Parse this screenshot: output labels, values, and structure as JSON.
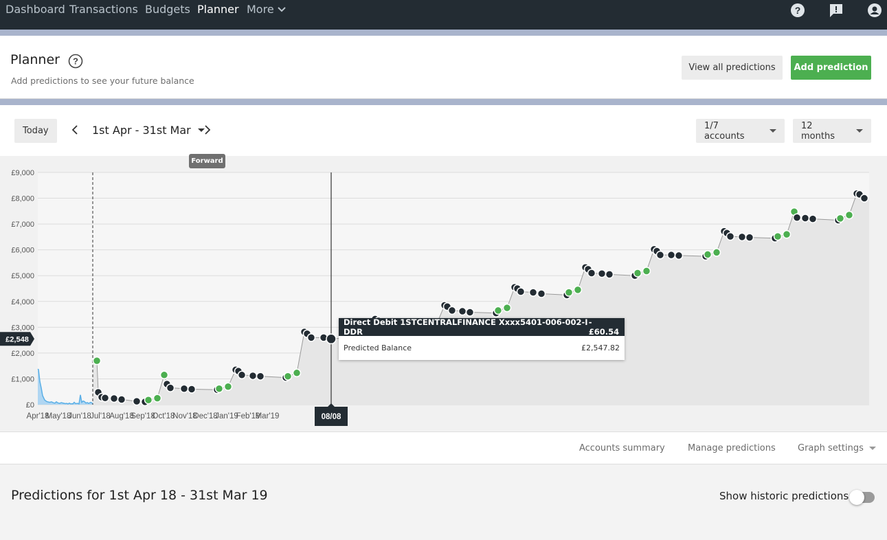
{
  "nav": {
    "items": [
      {
        "label": "Dashboard"
      },
      {
        "label": "Transactions"
      },
      {
        "label": "Budgets"
      },
      {
        "label": "Planner",
        "active": true
      },
      {
        "label": "More"
      }
    ],
    "icons": [
      "help-icon",
      "feedback-icon",
      "account-icon"
    ]
  },
  "header": {
    "title": "Planner",
    "subtitle": "Add predictions to see your future balance",
    "view_all_label": "View all predictions",
    "add_label": "Add prediction"
  },
  "controls": {
    "today_label": "Today",
    "date_range": "1st Apr - 31st Mar",
    "accounts_label": "1/7 accounts",
    "period_label": "12 months",
    "forward_tooltip": "Forward"
  },
  "chart_data": {
    "type": "line",
    "y_ticks": [
      "£0",
      "£1,000",
      "£2,000",
      "£3,000",
      "£4,000",
      "£5,000",
      "£6,000",
      "£7,000",
      "£8,000",
      "£9,000"
    ],
    "ylim": [
      0,
      9000
    ],
    "x_ticks": [
      "Apr'18",
      "May'18",
      "Jun'18",
      "Jul'18",
      "Aug'18",
      "Sep'18",
      "Oct'18",
      "Nov'18",
      "Dec'18",
      "Jan'19",
      "Feb'19",
      "Mar'19"
    ],
    "grid": true,
    "current_balance_label": "£2,548",
    "cursor_date_label": "08/08",
    "colors": {
      "debit": "#232c33",
      "credit": "#4caf50",
      "history": "#5aafe6",
      "history_fill": "#a9d3f2",
      "area": "#e6e6e6"
    },
    "history": [
      [
        0,
        1380
      ],
      [
        1,
        1360
      ],
      [
        3,
        900
      ],
      [
        5,
        650
      ],
      [
        7,
        350
      ],
      [
        10,
        180
      ],
      [
        13,
        120
      ],
      [
        17,
        90
      ],
      [
        20,
        110
      ],
      [
        23,
        70
      ],
      [
        25,
        60
      ],
      [
        27,
        110
      ],
      [
        29,
        70
      ],
      [
        32,
        50
      ],
      [
        34,
        80
      ],
      [
        37,
        60
      ],
      [
        40,
        40
      ],
      [
        42,
        50
      ],
      [
        44,
        30
      ],
      [
        46,
        60
      ],
      [
        48,
        30
      ],
      [
        50,
        40
      ],
      [
        51,
        30
      ],
      [
        53,
        90
      ],
      [
        55,
        40
      ],
      [
        58,
        50
      ],
      [
        60,
        30
      ],
      [
        62,
        380
      ],
      [
        64,
        90
      ],
      [
        66,
        140
      ],
      [
        68,
        120
      ],
      [
        70,
        60
      ],
      [
        72,
        80
      ],
      [
        74,
        50
      ],
      [
        77,
        90
      ],
      [
        80,
        50
      ]
    ],
    "today_x": 80,
    "cursor_x": 427,
    "predicted_points": [
      {
        "x": 86,
        "y": 1700,
        "t": "c"
      },
      {
        "x": 88,
        "y": 480,
        "t": "d"
      },
      {
        "x": 93,
        "y": 290,
        "t": "d"
      },
      {
        "x": 98,
        "y": 260,
        "t": "d"
      },
      {
        "x": 111,
        "y": 240,
        "t": "d"
      },
      {
        "x": 122,
        "y": 200,
        "t": "d"
      },
      {
        "x": 144,
        "y": 130,
        "t": "d"
      },
      {
        "x": 156,
        "y": 110,
        "t": "d"
      },
      {
        "x": 161,
        "y": 180,
        "t": "c"
      },
      {
        "x": 174,
        "y": 250,
        "t": "c"
      },
      {
        "x": 184,
        "y": 1150,
        "t": "c"
      },
      {
        "x": 188,
        "y": 800,
        "t": "d"
      },
      {
        "x": 193,
        "y": 650,
        "t": "d"
      },
      {
        "x": 213,
        "y": 620,
        "t": "d"
      },
      {
        "x": 224,
        "y": 600,
        "t": "d"
      },
      {
        "x": 261,
        "y": 580,
        "t": "d"
      },
      {
        "x": 264,
        "y": 620,
        "t": "c"
      },
      {
        "x": 277,
        "y": 700,
        "t": "c"
      },
      {
        "x": 288,
        "y": 1350,
        "t": "d"
      },
      {
        "x": 292,
        "y": 1300,
        "t": "d"
      },
      {
        "x": 297,
        "y": 1150,
        "t": "d"
      },
      {
        "x": 313,
        "y": 1120,
        "t": "d"
      },
      {
        "x": 324,
        "y": 1100,
        "t": "d"
      },
      {
        "x": 361,
        "y": 1050,
        "t": "d"
      },
      {
        "x": 364,
        "y": 1100,
        "t": "c"
      },
      {
        "x": 377,
        "y": 1230,
        "t": "c"
      },
      {
        "x": 388,
        "y": 2820,
        "t": "d"
      },
      {
        "x": 392,
        "y": 2750,
        "t": "d"
      },
      {
        "x": 398,
        "y": 2600,
        "t": "d"
      },
      {
        "x": 416,
        "y": 2600,
        "t": "d"
      },
      {
        "x": 427,
        "y": 2548,
        "t": "d"
      },
      {
        "x": 462,
        "y": 2600,
        "t": "d"
      },
      {
        "x": 467,
        "y": 2600,
        "t": "c"
      },
      {
        "x": 480,
        "y": 2700,
        "t": "c"
      },
      {
        "x": 491,
        "y": 3320,
        "t": "d"
      },
      {
        "x": 496,
        "y": 3250,
        "t": "d"
      },
      {
        "x": 501,
        "y": 3100,
        "t": "d"
      },
      {
        "x": 518,
        "y": 3050,
        "t": "d"
      },
      {
        "x": 529,
        "y": 3000,
        "t": "d"
      },
      {
        "x": 565,
        "y": 2950,
        "t": "d"
      },
      {
        "x": 568,
        "y": 3050,
        "t": "c"
      },
      {
        "x": 581,
        "y": 3150,
        "t": "c"
      },
      {
        "x": 592,
        "y": 3850,
        "t": "d"
      },
      {
        "x": 596,
        "y": 3800,
        "t": "d"
      },
      {
        "x": 603,
        "y": 3650,
        "t": "d"
      },
      {
        "x": 618,
        "y": 3620,
        "t": "d"
      },
      {
        "x": 629,
        "y": 3580,
        "t": "d"
      },
      {
        "x": 667,
        "y": 3550,
        "t": "d"
      },
      {
        "x": 670,
        "y": 3650,
        "t": "c"
      },
      {
        "x": 683,
        "y": 3750,
        "t": "c"
      },
      {
        "x": 694,
        "y": 4550,
        "t": "d"
      },
      {
        "x": 698,
        "y": 4500,
        "t": "d"
      },
      {
        "x": 703,
        "y": 4380,
        "t": "d"
      },
      {
        "x": 721,
        "y": 4350,
        "t": "d"
      },
      {
        "x": 733,
        "y": 4300,
        "t": "d"
      },
      {
        "x": 770,
        "y": 4250,
        "t": "d"
      },
      {
        "x": 773,
        "y": 4350,
        "t": "c"
      },
      {
        "x": 786,
        "y": 4450,
        "t": "c"
      },
      {
        "x": 797,
        "y": 5320,
        "t": "d"
      },
      {
        "x": 801,
        "y": 5250,
        "t": "d"
      },
      {
        "x": 806,
        "y": 5100,
        "t": "d"
      },
      {
        "x": 821,
        "y": 5080,
        "t": "d"
      },
      {
        "x": 832,
        "y": 5050,
        "t": "d"
      },
      {
        "x": 869,
        "y": 5000,
        "t": "d"
      },
      {
        "x": 873,
        "y": 5100,
        "t": "c"
      },
      {
        "x": 886,
        "y": 5180,
        "t": "c"
      },
      {
        "x": 897,
        "y": 6020,
        "t": "d"
      },
      {
        "x": 901,
        "y": 5950,
        "t": "d"
      },
      {
        "x": 906,
        "y": 5800,
        "t": "d"
      },
      {
        "x": 922,
        "y": 5800,
        "t": "d"
      },
      {
        "x": 933,
        "y": 5780,
        "t": "d"
      },
      {
        "x": 972,
        "y": 5750,
        "t": "d"
      },
      {
        "x": 975,
        "y": 5820,
        "t": "c"
      },
      {
        "x": 988,
        "y": 5900,
        "t": "c"
      },
      {
        "x": 999,
        "y": 6720,
        "t": "d"
      },
      {
        "x": 1003,
        "y": 6650,
        "t": "d"
      },
      {
        "x": 1008,
        "y": 6520,
        "t": "d"
      },
      {
        "x": 1025,
        "y": 6500,
        "t": "d"
      },
      {
        "x": 1036,
        "y": 6480,
        "t": "d"
      },
      {
        "x": 1073,
        "y": 6450,
        "t": "d"
      },
      {
        "x": 1077,
        "y": 6520,
        "t": "c"
      },
      {
        "x": 1090,
        "y": 6600,
        "t": "c"
      },
      {
        "x": 1101,
        "y": 7480,
        "t": "c"
      },
      {
        "x": 1105,
        "y": 7250,
        "t": "d"
      },
      {
        "x": 1117,
        "y": 7230,
        "t": "d"
      },
      {
        "x": 1128,
        "y": 7200,
        "t": "d"
      },
      {
        "x": 1165,
        "y": 7150,
        "t": "d"
      },
      {
        "x": 1168,
        "y": 7220,
        "t": "c"
      },
      {
        "x": 1181,
        "y": 7350,
        "t": "c"
      },
      {
        "x": 1192,
        "y": 8180,
        "t": "d"
      },
      {
        "x": 1196,
        "y": 8150,
        "t": "d"
      },
      {
        "x": 1203,
        "y": 8000,
        "t": "d"
      }
    ]
  },
  "tooltip": {
    "title": "Direct Debit 1STCENTRALFINANCE Xxxx5401-006-002-I DDR",
    "amount": "-£60.54",
    "label": "Predicted Balance",
    "value": "£2,547.82"
  },
  "footer_links": {
    "accounts_summary": "Accounts summary",
    "manage_predictions": "Manage predictions",
    "graph_settings": "Graph settings"
  },
  "predictions_section": {
    "title": "Predictions for 1st Apr 18 - 31st Mar 19",
    "historic_label": "Show historic predictions",
    "historic_on": false
  }
}
